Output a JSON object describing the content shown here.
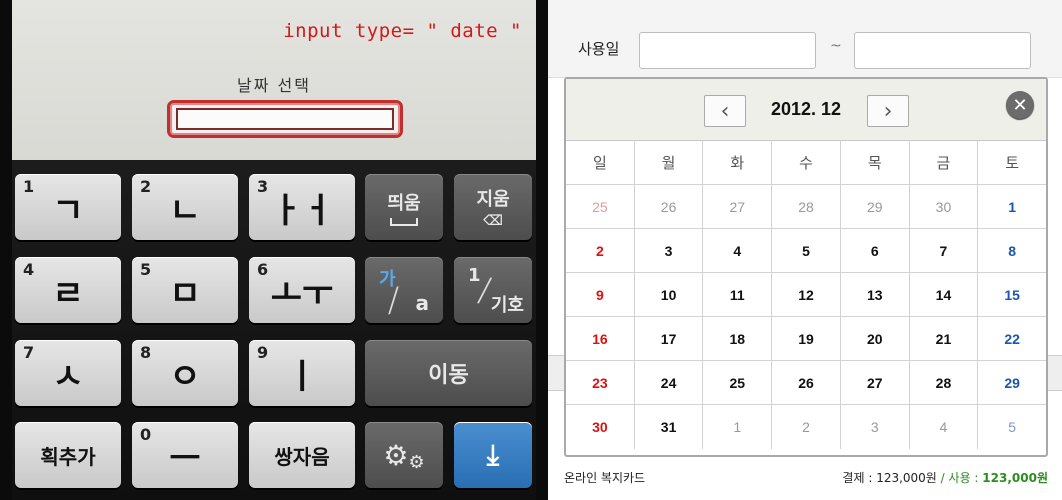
{
  "phone": {
    "annotation": "input type= \" date \"",
    "date_label": "날짜 선택",
    "date_value": "",
    "keys": [
      {
        "num": "1",
        "label": "ㄱ",
        "name": "key-giyeok"
      },
      {
        "num": "2",
        "label": "ㄴ",
        "name": "key-nieun"
      },
      {
        "num": "3",
        "label": "ㅏㅓ",
        "name": "key-a-eo"
      },
      {
        "num": "",
        "label": "띄움",
        "name": "key-space"
      },
      {
        "num": "",
        "label": "지움",
        "name": "key-delete"
      },
      {
        "num": "4",
        "label": "ㄹ",
        "name": "key-rieul"
      },
      {
        "num": "5",
        "label": "ㅁ",
        "name": "key-mieum"
      },
      {
        "num": "6",
        "label": "ㅗㅜ",
        "name": "key-o-u"
      },
      {
        "num": "",
        "label": "가",
        "sub": "a",
        "name": "key-lang-toggle"
      },
      {
        "num": "1",
        "label": "기호",
        "name": "key-symbols"
      },
      {
        "num": "7",
        "label": "ㅅ",
        "name": "key-siot"
      },
      {
        "num": "8",
        "label": "ㅇ",
        "name": "key-ieung"
      },
      {
        "num": "9",
        "label": "ㅣ",
        "name": "key-i"
      },
      {
        "num": "",
        "label": "이동",
        "name": "key-move"
      },
      {
        "num": "",
        "label": "획추가",
        "name": "key-add-stroke"
      },
      {
        "num": "0",
        "label": "ㅡ",
        "name": "key-eu"
      },
      {
        "num": "",
        "label": "쌍자음",
        "name": "key-double-consonant"
      },
      {
        "num": "",
        "label": "",
        "name": "key-settings"
      },
      {
        "num": "",
        "label": "",
        "name": "key-hide-keyboard"
      }
    ]
  },
  "picker": {
    "filter_label": "사용일",
    "date_from_value": "",
    "date_to_value": "",
    "tilde": "~",
    "month_title": "2012. 12",
    "prev_icon": "chevron-left-icon",
    "next_icon": "chevron-right-icon",
    "close_icon": "close-icon",
    "weekdays": [
      "일",
      "월",
      "화",
      "수",
      "목",
      "금",
      "토"
    ],
    "weeks": [
      [
        {
          "d": "25",
          "m": true
        },
        {
          "d": "26",
          "m": true
        },
        {
          "d": "27",
          "m": true
        },
        {
          "d": "28",
          "m": true
        },
        {
          "d": "29",
          "m": true
        },
        {
          "d": "30",
          "m": true
        },
        {
          "d": "1",
          "m": false
        }
      ],
      [
        {
          "d": "2",
          "m": false
        },
        {
          "d": "3",
          "m": false
        },
        {
          "d": "4",
          "m": false
        },
        {
          "d": "5",
          "m": false
        },
        {
          "d": "6",
          "m": false
        },
        {
          "d": "7",
          "m": false
        },
        {
          "d": "8",
          "m": false
        }
      ],
      [
        {
          "d": "9",
          "m": false
        },
        {
          "d": "10",
          "m": false
        },
        {
          "d": "11",
          "m": false
        },
        {
          "d": "12",
          "m": false
        },
        {
          "d": "13",
          "m": false
        },
        {
          "d": "14",
          "m": false
        },
        {
          "d": "15",
          "m": false
        }
      ],
      [
        {
          "d": "16",
          "m": false
        },
        {
          "d": "17",
          "m": false
        },
        {
          "d": "18",
          "m": false
        },
        {
          "d": "19",
          "m": false
        },
        {
          "d": "20",
          "m": false
        },
        {
          "d": "21",
          "m": false
        },
        {
          "d": "22",
          "m": false
        }
      ],
      [
        {
          "d": "23",
          "m": false
        },
        {
          "d": "24",
          "m": false
        },
        {
          "d": "25",
          "m": false
        },
        {
          "d": "26",
          "m": false
        },
        {
          "d": "27",
          "m": false
        },
        {
          "d": "28",
          "m": false
        },
        {
          "d": "29",
          "m": false
        }
      ],
      [
        {
          "d": "30",
          "m": false
        },
        {
          "d": "31",
          "m": false
        },
        {
          "d": "1",
          "m": true
        },
        {
          "d": "2",
          "m": true
        },
        {
          "d": "3",
          "m": true
        },
        {
          "d": "4",
          "m": true
        },
        {
          "d": "5",
          "m": true
        }
      ]
    ],
    "footer_left": "온라인 복지카드",
    "footer_payment_label": "결제 : ",
    "footer_payment_value": "123,000원",
    "footer_sep": " / ",
    "footer_use_label": "사용 : ",
    "footer_use_value": "123,000원",
    "colors": {
      "sunday": "#dd1111",
      "saturday": "#1a56b0",
      "accent_green": "#2d8c1f"
    }
  }
}
